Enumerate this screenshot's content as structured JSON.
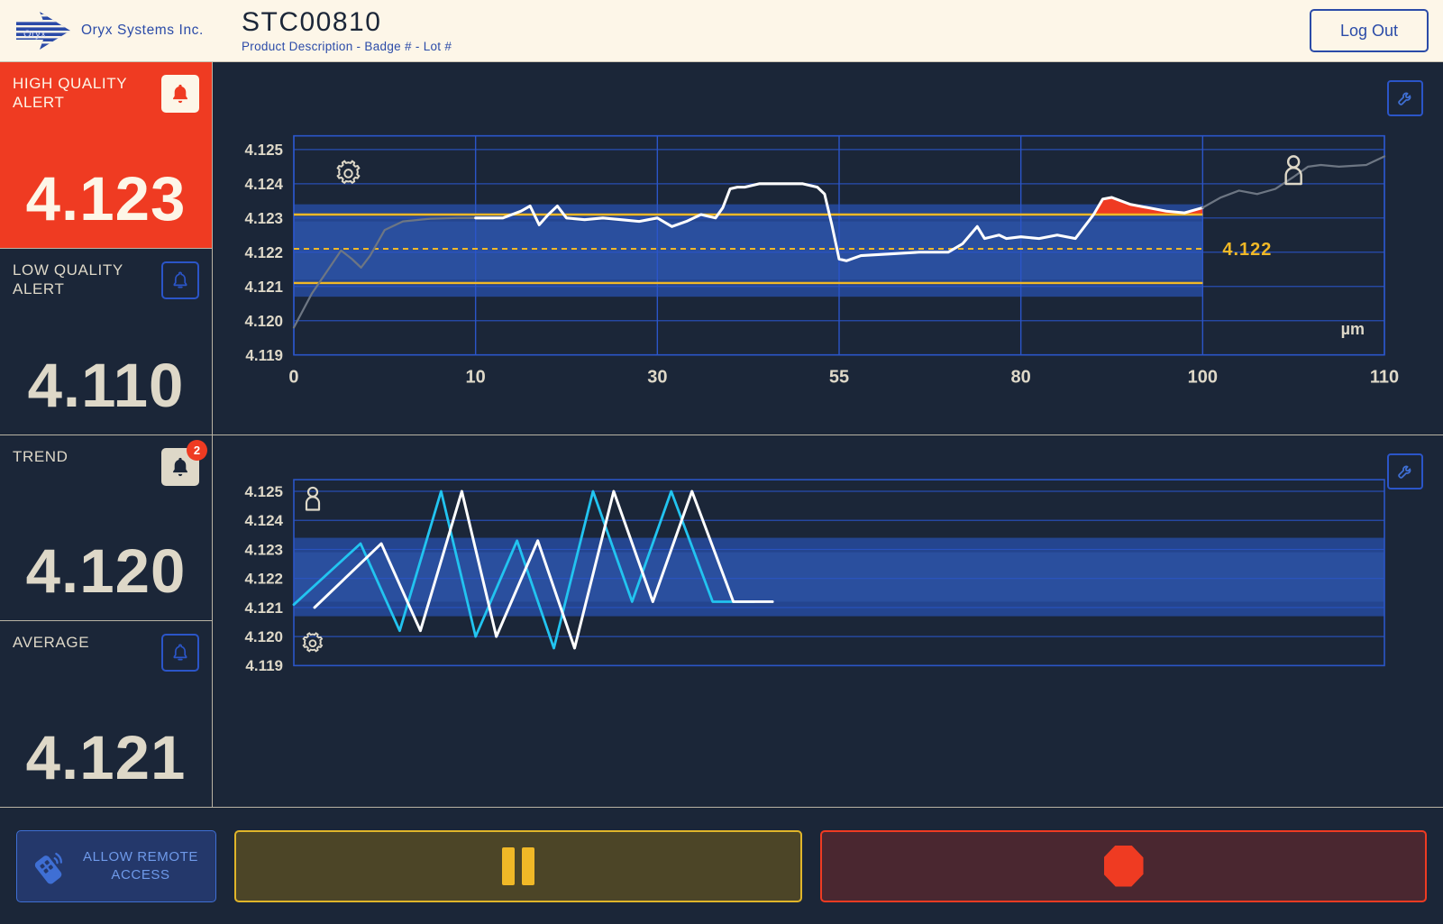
{
  "header": {
    "company": "Oryx Systems Inc.",
    "logo_word": "Oryx",
    "title": "STC00810",
    "subtitle": "Product Description - Badge # - Lot #",
    "logout_label": "Log Out"
  },
  "sidebar": {
    "kpis": [
      {
        "label": "HIGH QUALITY ALERT",
        "value": "4.123",
        "state": "alert",
        "bell": "bell-icon",
        "bell_style": "filled-light",
        "badge": null
      },
      {
        "label": "LOW QUALITY ALERT",
        "value": "4.110",
        "state": "normal",
        "bell": "bell-icon",
        "bell_style": "outlined",
        "badge": null
      },
      {
        "label": "TREND",
        "value": "4.120",
        "state": "normal",
        "bell": "bell-icon",
        "bell_style": "filled-beige",
        "badge": "2"
      },
      {
        "label": "AVERAGE",
        "value": "4.121",
        "state": "normal",
        "bell": "bell-icon",
        "bell_style": "outlined",
        "badge": null
      }
    ]
  },
  "footer": {
    "remote_label_line1": "ALLOW REMOTE",
    "remote_label_line2": "ACCESS",
    "remote_icon": "remote-control-icon",
    "pause_icon": "pause-icon",
    "stop_icon": "stop-octagon-icon"
  },
  "colors": {
    "alert_red": "#ef3b22",
    "panel_bg": "#1b2638",
    "band_blue": "#24458f",
    "band_blue_light": "#2a4f9e",
    "grid_blue": "#2b55c8",
    "limit_yellow": "#f0b827",
    "trace_white": "#ffffff",
    "trace_cyan": "#22c4f0",
    "trace_gray": "#6d7683",
    "text_cream": "#ded8c8",
    "header_bg": "#fdf6e8",
    "brand_blue": "#2b4ba8"
  },
  "chart_data": [
    {
      "id": "quality-trace-chart",
      "type": "line",
      "title": "",
      "xlabel": "",
      "ylabel": "µm",
      "unit_label": "µm",
      "current_value_label": "4.122",
      "xticks": [
        0,
        10,
        30,
        55,
        80,
        100,
        110
      ],
      "xtick_labels": [
        "0",
        "10",
        "30",
        "55",
        "80",
        "100",
        "110"
      ],
      "yticks": [
        4.119,
        4.12,
        4.121,
        4.122,
        4.123,
        4.124,
        4.125
      ],
      "ytick_labels": [
        "4.119",
        "4.120",
        "4.121",
        "4.122",
        "4.123",
        "4.124",
        "4.125"
      ],
      "ylim": [
        4.119,
        4.1254
      ],
      "grid": true,
      "spec_band": {
        "low": 4.1207,
        "high": 4.1234,
        "color": "#24458f"
      },
      "spec_band_inner": {
        "low": 4.1212,
        "high": 4.1229,
        "color": "#2a4f9e"
      },
      "limit_lines": [
        {
          "name": "upper-control-limit",
          "value": 4.1231,
          "color": "#f0b827",
          "style": "solid"
        },
        {
          "name": "lower-control-limit",
          "value": 4.1211,
          "color": "#f0b827",
          "style": "solid"
        },
        {
          "name": "target-line",
          "value": 4.1221,
          "color": "#f0b827",
          "style": "dashed"
        }
      ],
      "series": [
        {
          "name": "history-trace",
          "color": "#6d7683",
          "style": "solid",
          "x": [
            0,
            1.0,
            1.9,
            2.6,
            3.2,
            3.7,
            4.2,
            5.0,
            6.0,
            7.5,
            9.0,
            10.0
          ],
          "y": [
            4.1198,
            4.1208,
            4.1215,
            4.12205,
            4.1218,
            4.12155,
            4.1219,
            4.12265,
            4.1229,
            4.12298,
            4.123,
            4.123
          ]
        },
        {
          "name": "live-trace",
          "color": "#ffffff",
          "style": "solid",
          "x": [
            10,
            13,
            15,
            16,
            17,
            18,
            19,
            20,
            22,
            24,
            26,
            28,
            30,
            32,
            34,
            36,
            38,
            39,
            40,
            41,
            42,
            44,
            47,
            50,
            52,
            53,
            54,
            55,
            56,
            58,
            62,
            66,
            70,
            72,
            74,
            75,
            76,
            77,
            78,
            80,
            82,
            84,
            86,
            88,
            89,
            90,
            91,
            92,
            94,
            96,
            98,
            100
          ],
          "y": [
            4.123,
            4.123,
            4.1232,
            4.12335,
            4.1228,
            4.1231,
            4.12335,
            4.123,
            4.12295,
            4.123,
            4.12295,
            4.1229,
            4.123,
            4.12275,
            4.1229,
            4.1231,
            4.123,
            4.1233,
            4.12385,
            4.1239,
            4.1239,
            4.124,
            4.124,
            4.124,
            4.1239,
            4.1237,
            4.1228,
            4.1218,
            4.12175,
            4.1219,
            4.12195,
            4.122,
            4.122,
            4.12225,
            4.12275,
            4.1224,
            4.12245,
            4.1225,
            4.1224,
            4.12245,
            4.1224,
            4.1225,
            4.1224,
            4.1231,
            4.12355,
            4.1236,
            4.1235,
            4.1234,
            4.1233,
            4.1232,
            4.12315,
            4.1233
          ]
        },
        {
          "name": "projection-trace",
          "color": "#6d7683",
          "style": "solid",
          "x": [
            100,
            101,
            102,
            103,
            104,
            105,
            105.8,
            106.5,
            107.5,
            109,
            110
          ],
          "y": [
            4.1233,
            4.1236,
            4.1238,
            4.1237,
            4.12385,
            4.1242,
            4.1245,
            4.12455,
            4.1245,
            4.12455,
            4.1248
          ]
        }
      ],
      "violation_fill": {
        "name": "out-of-spec-region",
        "color": "#ef3b22",
        "from_x": 88,
        "to_x": 100,
        "baseline": 4.1231
      },
      "annotations": [
        {
          "name": "operator-marker",
          "icon": "person-icon",
          "x": 105,
          "y": 4.1244
        },
        {
          "name": "settings-marker",
          "icon": "gear-icon",
          "x": 3,
          "y": 4.1243
        }
      ]
    },
    {
      "id": "sampling-zigzag-chart",
      "type": "line",
      "title": "",
      "xlabel": "",
      "ylabel": "",
      "yticks": [
        4.119,
        4.12,
        4.121,
        4.122,
        4.123,
        4.124,
        4.125
      ],
      "ytick_labels": [
        "4.119",
        "4.120",
        "4.121",
        "4.122",
        "4.123",
        "4.124",
        "4.125"
      ],
      "ylim": [
        4.119,
        4.1254
      ],
      "grid": true,
      "spec_band": {
        "low": 4.1207,
        "high": 4.1234,
        "color": "#24458f"
      },
      "spec_band_inner": {
        "low": 4.1212,
        "high": 4.1229,
        "color": "#2a4f9e"
      },
      "series": [
        {
          "name": "sample-a",
          "color": "#22c4f0",
          "style": "solid",
          "x": [
            0,
            1.45,
            2.3,
            3.2,
            3.95,
            4.85,
            5.65,
            6.5,
            7.35,
            8.2,
            9.1,
            10.0
          ],
          "y": [
            4.1211,
            4.1232,
            4.1202,
            4.125,
            4.12,
            4.1233,
            4.1196,
            4.125,
            4.1212,
            4.125,
            4.1212,
            4.1212
          ]
        },
        {
          "name": "sample-b",
          "color": "#ffffff",
          "style": "solid",
          "x": [
            0.45,
            1.9,
            2.75,
            3.65,
            4.4,
            5.3,
            6.1,
            6.95,
            7.8,
            8.65,
            9.55,
            10.4
          ],
          "y": [
            4.121,
            4.1232,
            4.1202,
            4.125,
            4.12,
            4.1233,
            4.1196,
            4.125,
            4.1212,
            4.125,
            4.1212,
            4.1212
          ]
        }
      ],
      "annotations": [
        {
          "name": "operator-marker",
          "icon": "person-icon"
        },
        {
          "name": "settings-marker",
          "icon": "gear-icon"
        }
      ]
    }
  ]
}
